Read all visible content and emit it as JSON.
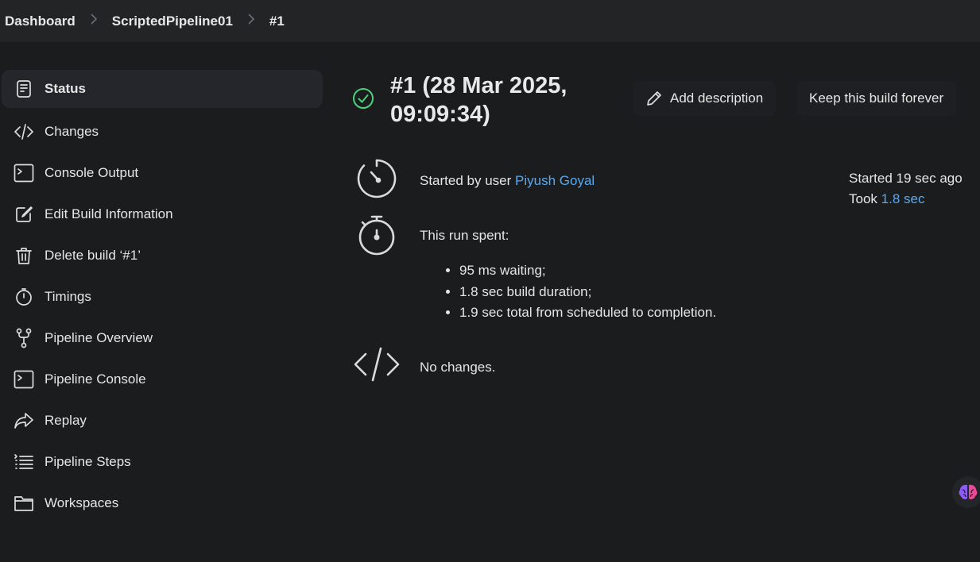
{
  "breadcrumb": {
    "items": [
      "Dashboard",
      "ScriptedPipeline01",
      "#1"
    ],
    "separator": ">"
  },
  "sidebar": {
    "items": [
      {
        "label": "Status",
        "icon": "document-icon",
        "active": true
      },
      {
        "label": "Changes",
        "icon": "code-icon"
      },
      {
        "label": "Console Output",
        "icon": "terminal-icon"
      },
      {
        "label": "Edit Build Information",
        "icon": "edit-icon"
      },
      {
        "label": "Delete build ‘#1’",
        "icon": "trash-icon"
      },
      {
        "label": "Timings",
        "icon": "stopwatch-icon"
      },
      {
        "label": "Pipeline Overview",
        "icon": "branch-icon"
      },
      {
        "label": "Pipeline Console",
        "icon": "terminal-icon"
      },
      {
        "label": "Replay",
        "icon": "share-arrow-icon"
      },
      {
        "label": "Pipeline Steps",
        "icon": "list-icon"
      },
      {
        "label": "Workspaces",
        "icon": "folder-icon"
      }
    ]
  },
  "build": {
    "title": "#1 (28 Mar 2025, 09:09:34)",
    "status": "success",
    "add_description_label": "Add description",
    "keep_forever_label": "Keep this build forever",
    "started_by_prefix": "Started by user",
    "started_by_user": "Piyush Goyal",
    "started_ago": "Started 19 sec ago",
    "took_prefix": "Took",
    "took_value": "1.8 sec",
    "run_spent_label": "This run spent:",
    "run_spent_items": [
      "95 ms waiting;",
      "1.8 sec build duration;",
      "1.9 sec total from scheduled to completion."
    ],
    "changes_text": "No changes."
  },
  "colors": {
    "background": "#1b1c1e",
    "topbar": "#222426",
    "link": "#5aa9f0",
    "success": "#4cd07d"
  }
}
